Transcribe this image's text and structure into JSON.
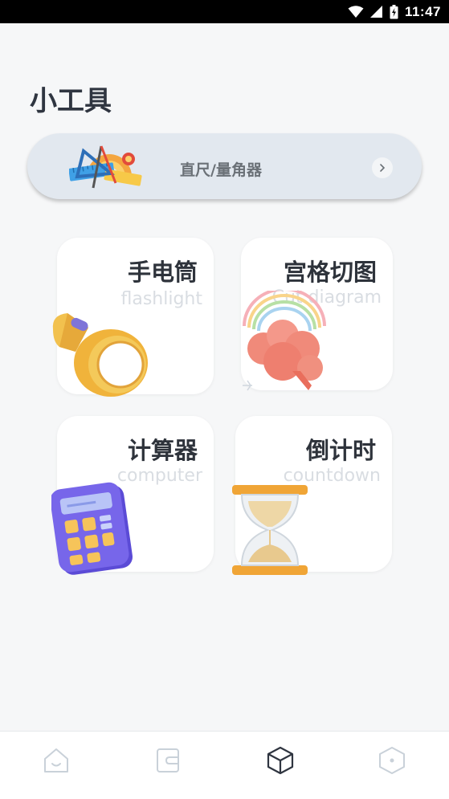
{
  "status_bar": {
    "time": "11:47"
  },
  "page": {
    "title": "小工具"
  },
  "banner": {
    "label": "直尺/量角器",
    "icon": "ruler-protractor-icon"
  },
  "tools": [
    {
      "title": "手电筒",
      "subtitle": "flashlight",
      "icon": "flashlight-icon"
    },
    {
      "title": "宫格切图",
      "subtitle": "Cut diagram",
      "icon": "cloud-rainbow-icon"
    },
    {
      "title": "计算器",
      "subtitle": "computer",
      "icon": "calculator-icon"
    },
    {
      "title": "倒计时",
      "subtitle": "countdown",
      "icon": "hourglass-icon"
    }
  ],
  "bottom_nav": {
    "items": [
      {
        "icon": "home-icon",
        "active": false
      },
      {
        "icon": "wallet-icon",
        "active": false
      },
      {
        "icon": "cube-icon",
        "active": true
      },
      {
        "icon": "hexagon-icon",
        "active": false
      }
    ]
  },
  "colors": {
    "active": "#2f3540",
    "inactive": "#c9d1d9",
    "background": "#f6f7f8"
  }
}
